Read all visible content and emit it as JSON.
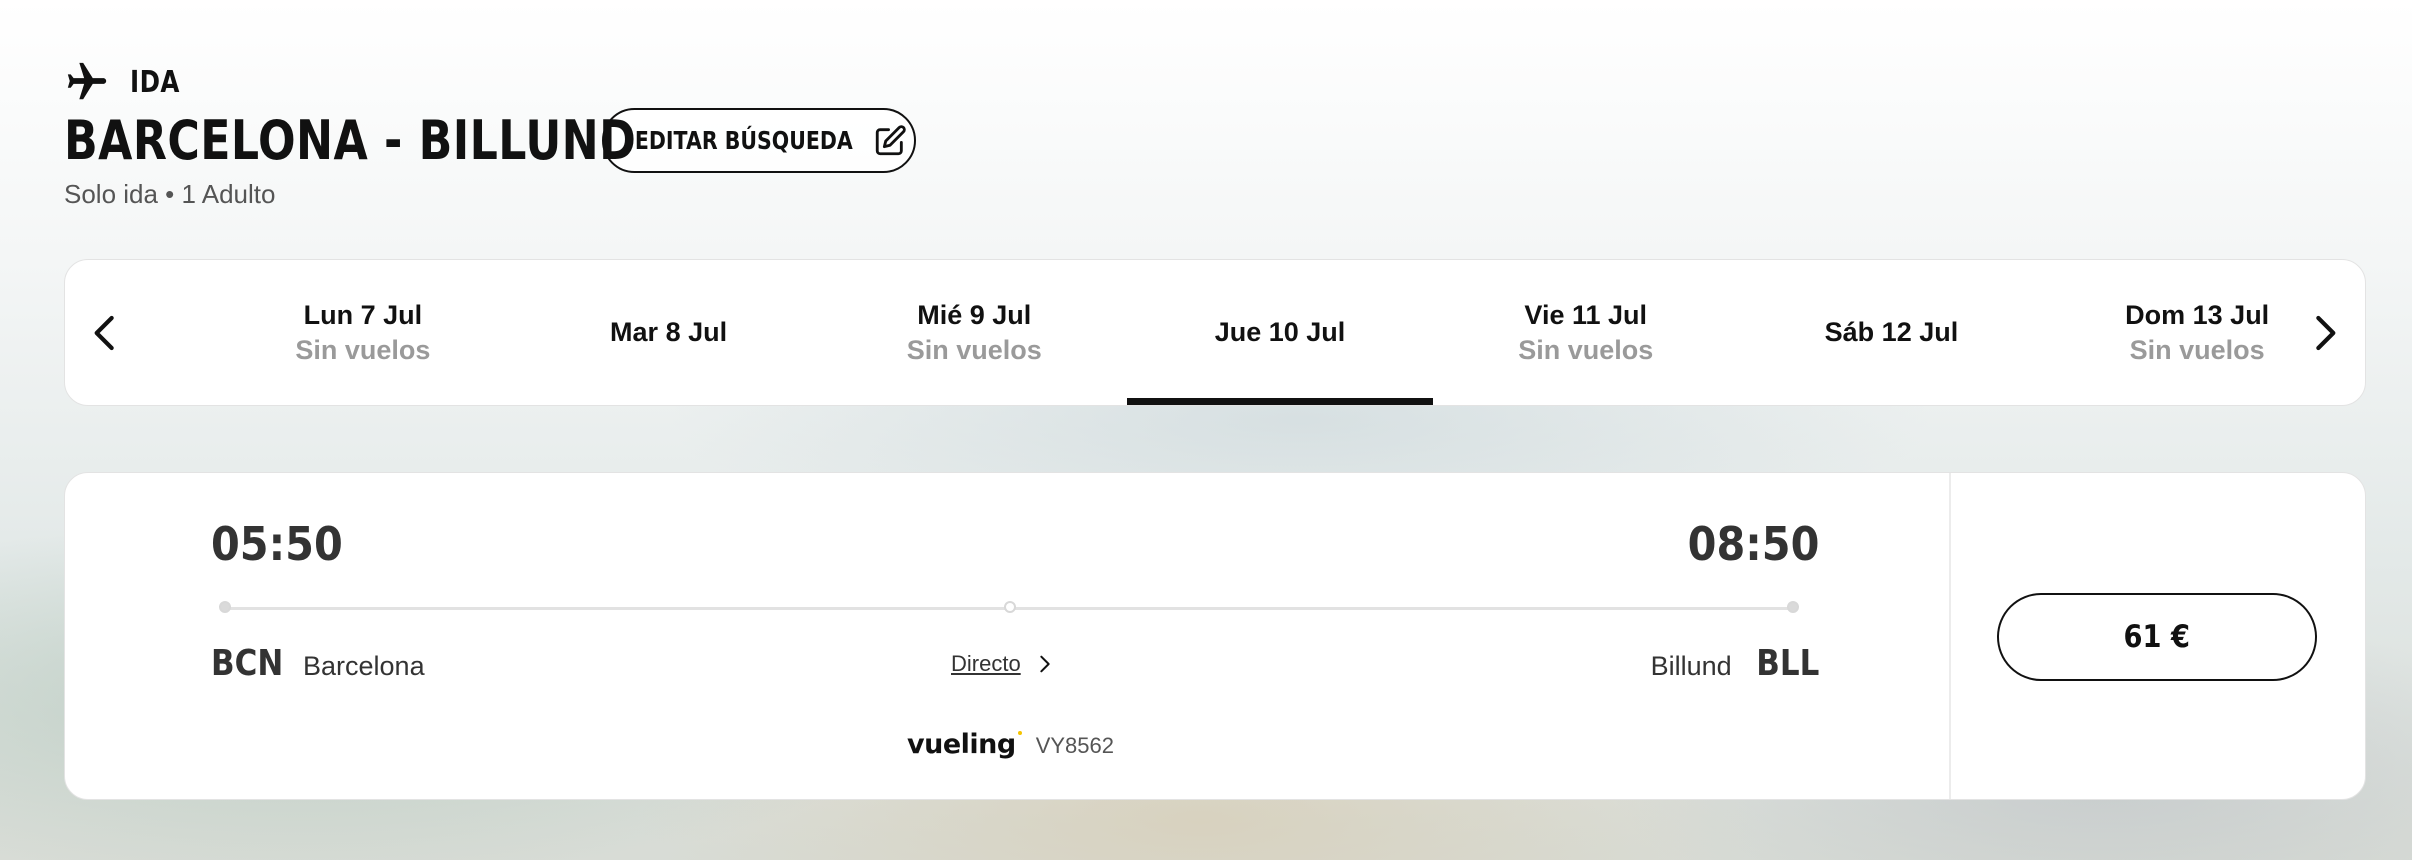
{
  "header": {
    "direction_label": "IDA",
    "route_title": "BARCELONA - BILLUND",
    "edit_button_label": "EDITAR BÚSQUEDA",
    "subtitle": "Solo ida • 1 Adulto"
  },
  "date_strip": {
    "days": [
      {
        "label": "Lun 7 Jul",
        "status": "Sin vuelos",
        "selected": false
      },
      {
        "label": "Mar 8 Jul",
        "status": "",
        "selected": false
      },
      {
        "label": "Mié 9 Jul",
        "status": "Sin vuelos",
        "selected": false
      },
      {
        "label": "Jue 10 Jul",
        "status": "",
        "selected": true
      },
      {
        "label": "Vie 11 Jul",
        "status": "Sin vuelos",
        "selected": false
      },
      {
        "label": "Sáb 12 Jul",
        "status": "",
        "selected": false
      },
      {
        "label": "Dom 13 Jul",
        "status": "Sin vuelos",
        "selected": false
      }
    ]
  },
  "flight": {
    "departure_time": "05:50",
    "arrival_time": "08:50",
    "origin_code": "BCN",
    "origin_city": "Barcelona",
    "destination_city": "Billund",
    "destination_code": "BLL",
    "stops_label": "Directo",
    "airline": "vueling",
    "flight_number": "VY8562",
    "price": "61 €"
  },
  "icons": {
    "direction": "airplane-icon",
    "edit": "edit-pencil-icon",
    "prev": "chevron-left-icon",
    "next": "chevron-right-icon",
    "details": "chevron-right-icon"
  },
  "colors": {
    "text_primary": "#111111",
    "text_muted": "#9a9a9a",
    "selected_indicator": "#111111",
    "logo_accent": "#f5c400"
  }
}
